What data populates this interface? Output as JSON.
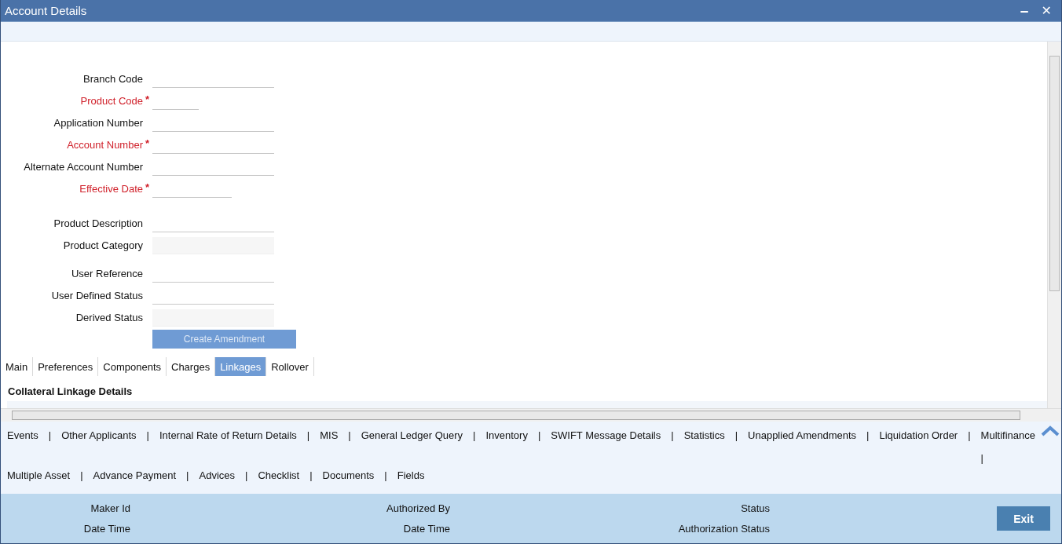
{
  "window": {
    "title": "Account Details",
    "minimize_label": "‒",
    "close_label": "✕"
  },
  "field_groups": [
    [
      {
        "label": "Branch Code",
        "required": false,
        "readonly": false,
        "kind": "text"
      },
      {
        "label": "Product Code",
        "required": true,
        "readonly": false,
        "kind": "code"
      },
      {
        "label": "Application Number",
        "required": false,
        "readonly": false,
        "kind": "text"
      },
      {
        "label": "Account Number",
        "required": true,
        "readonly": false,
        "kind": "text"
      },
      {
        "label": "Alternate Account Number",
        "required": false,
        "readonly": false,
        "kind": "text"
      },
      {
        "label": "Effective Date",
        "required": true,
        "readonly": false,
        "kind": "date"
      }
    ],
    [
      {
        "label": "Product Description",
        "required": false,
        "readonly": false,
        "kind": "text"
      },
      {
        "label": "Product Category",
        "required": false,
        "readonly": true,
        "kind": "text"
      }
    ],
    [
      {
        "label": "User Reference",
        "required": false,
        "readonly": false,
        "kind": "text"
      },
      {
        "label": "User Defined Status",
        "required": false,
        "readonly": false,
        "kind": "text"
      },
      {
        "label": "Derived Status",
        "required": false,
        "readonly": true,
        "kind": "text"
      }
    ]
  ],
  "required_mark": "*",
  "action_button": {
    "label": "Create Amendment",
    "disabled": true
  },
  "tabs": [
    {
      "label": "Main",
      "selected": false
    },
    {
      "label": "Preferences",
      "selected": false
    },
    {
      "label": "Components",
      "selected": false
    },
    {
      "label": "Charges",
      "selected": false
    },
    {
      "label": "Linkages",
      "selected": true
    },
    {
      "label": "Rollover",
      "selected": false
    }
  ],
  "section_title": "Collateral Linkage Details",
  "link_rows": [
    [
      {
        "kind": "link",
        "label": "Events"
      },
      {
        "kind": "separator",
        "label": "|"
      },
      {
        "kind": "link",
        "label": "Other Applicants"
      },
      {
        "kind": "separator",
        "label": "|"
      },
      {
        "kind": "link",
        "label": "Internal Rate of Return Details"
      },
      {
        "kind": "separator",
        "label": "|"
      },
      {
        "kind": "link",
        "label": "MIS"
      },
      {
        "kind": "separator",
        "label": "|"
      },
      {
        "kind": "link",
        "label": "General Ledger Query"
      },
      {
        "kind": "separator",
        "label": "|"
      },
      {
        "kind": "link",
        "label": "Inventory"
      },
      {
        "kind": "separator",
        "label": "|"
      },
      {
        "kind": "link",
        "label": "SWIFT Message Details"
      },
      {
        "kind": "separator",
        "label": "|"
      },
      {
        "kind": "link",
        "label": "Statistics"
      },
      {
        "kind": "separator",
        "label": "|"
      },
      {
        "kind": "link",
        "label": "Unapplied Amendments"
      },
      {
        "kind": "separator",
        "label": "|"
      },
      {
        "kind": "link",
        "label": "Liquidation Order"
      },
      {
        "kind": "separator",
        "label": "|"
      },
      {
        "kind": "link",
        "label": "Multifinance"
      },
      {
        "kind": "wrapped_separator",
        "label": "|"
      }
    ],
    [
      {
        "kind": "link",
        "label": "Multiple Asset"
      },
      {
        "kind": "separator",
        "label": "|"
      },
      {
        "kind": "link",
        "label": "Advance Payment"
      },
      {
        "kind": "separator",
        "label": "|"
      },
      {
        "kind": "link",
        "label": "Advices"
      },
      {
        "kind": "separator",
        "label": "|"
      },
      {
        "kind": "link",
        "label": "Checklist"
      },
      {
        "kind": "separator",
        "label": "|"
      },
      {
        "kind": "link",
        "label": "Documents"
      },
      {
        "kind": "separator",
        "label": "|"
      },
      {
        "kind": "link",
        "label": "Fields"
      }
    ]
  ],
  "audit_columns": [
    [
      "Maker Id",
      "Date Time"
    ],
    [
      "Authorized By",
      "Date Time"
    ],
    [
      "Status",
      "Authorization Status"
    ]
  ],
  "exit_button": "Exit"
}
